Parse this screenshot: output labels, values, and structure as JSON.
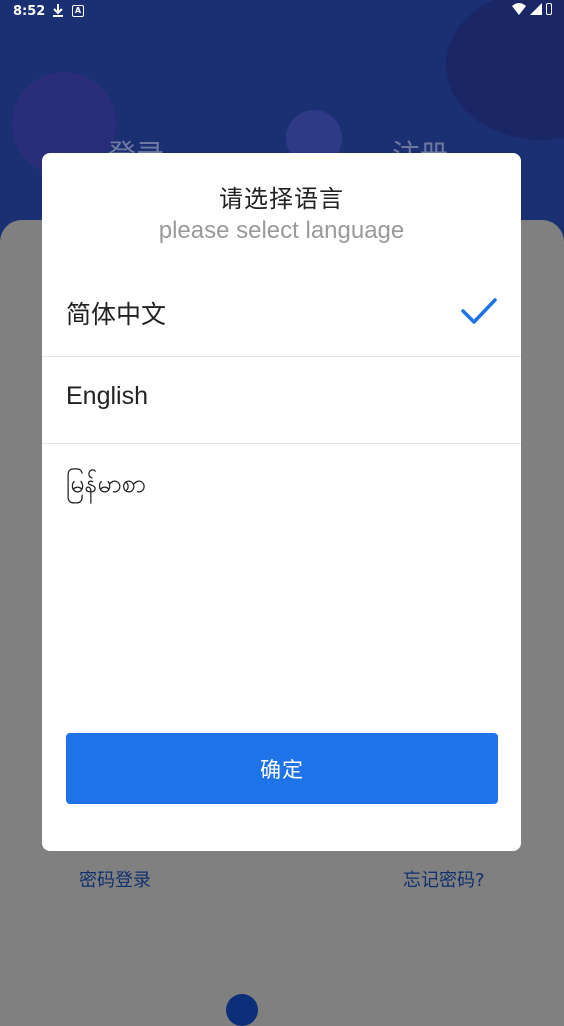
{
  "status_bar": {
    "time": "8:52",
    "download_icon": "download-icon",
    "app_icon": "A",
    "wifi_icon": "wifi-icon",
    "signal_icon": "signal-icon",
    "battery_icon": "battery-icon"
  },
  "background": {
    "tab_login": "登录",
    "tab_register": "注册",
    "link_password_login": "密码登录",
    "link_forgot_password": "忘记密码?"
  },
  "dialog": {
    "title": "请选择语言",
    "subtitle": "please select language",
    "languages": [
      {
        "label": "简体中文",
        "selected": true
      },
      {
        "label": "English",
        "selected": false
      },
      {
        "label": "မြန်မာစာ",
        "selected": false
      }
    ],
    "confirm_label": "确定"
  },
  "colors": {
    "accent": "#1f73e8",
    "overlay": "#808080",
    "header_bg": "#1b2f73"
  }
}
